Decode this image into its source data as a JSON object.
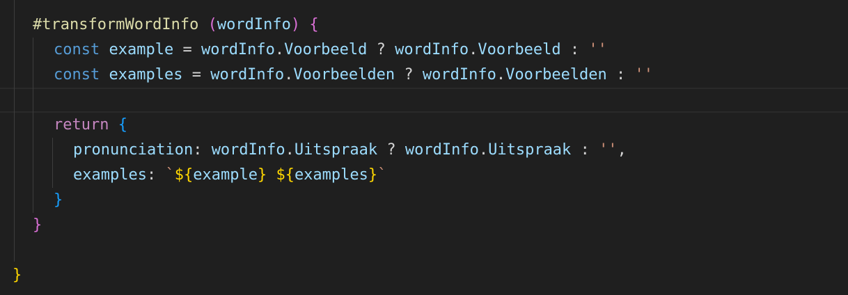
{
  "code": {
    "line1": {
      "method": "#transformWordInfo",
      "paren_open": "(",
      "param": "wordInfo",
      "paren_close": ")",
      "brace_open": "{"
    },
    "line2": {
      "keyword": "const",
      "name": "example",
      "eq": "=",
      "obj1": "wordInfo",
      "dot1": ".",
      "prop1": "Voorbeeld",
      "q": "?",
      "obj2": "wordInfo",
      "dot2": ".",
      "prop2": "Voorbeeld",
      "colon": ":",
      "str": "''"
    },
    "line3": {
      "keyword": "const",
      "name": "examples",
      "eq": "=",
      "obj1": "wordInfo",
      "dot1": ".",
      "prop1": "Voorbeelden",
      "q": "?",
      "obj2": "wordInfo",
      "dot2": ".",
      "prop2": "Voorbeelden",
      "colon": ":",
      "str": "''"
    },
    "line5": {
      "keyword": "return",
      "brace_open": "{"
    },
    "line6": {
      "key": "pronunciation",
      "colon1": ":",
      "obj1": "wordInfo",
      "dot1": ".",
      "prop1": "Uitspraak",
      "q": "?",
      "obj2": "wordInfo",
      "dot2": ".",
      "prop2": "Uitspraak",
      "colon2": ":",
      "str": "''",
      "comma": ","
    },
    "line7": {
      "key": "examples",
      "colon": ":",
      "backtick_open": "`",
      "dollar1": "${",
      "var1": "example",
      "close1": "}",
      "space": " ",
      "dollar2": "${",
      "var2": "examples",
      "close2": "}",
      "backtick_close": "`"
    },
    "line8": {
      "brace_close": "}"
    },
    "line9": {
      "brace_close": "}"
    },
    "line11": {
      "brace_close": "}"
    }
  }
}
